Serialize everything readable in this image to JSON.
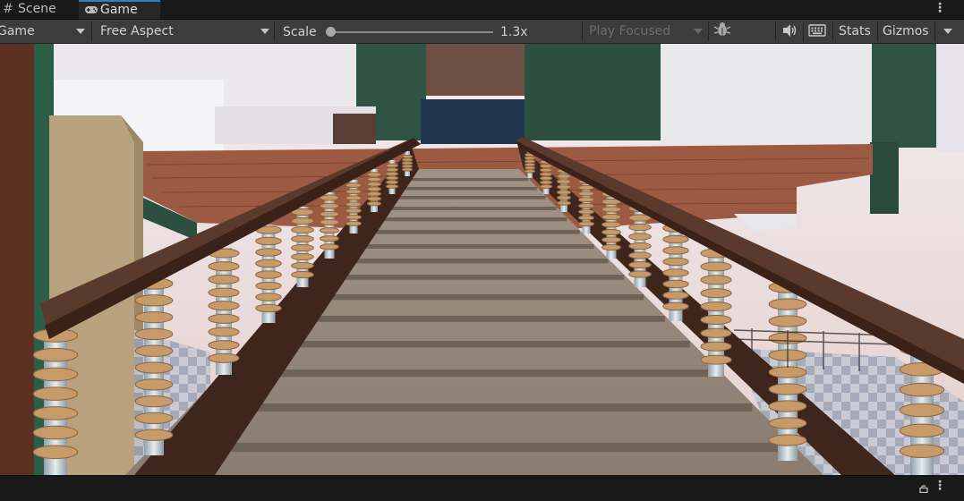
{
  "tabs": {
    "scene": {
      "label": "Scene",
      "icon": "grid-icon"
    },
    "game": {
      "label": "Game",
      "icon": "gamepad-icon"
    },
    "menu_icon": "kebab-menu-icon"
  },
  "toolbar": {
    "display_dropdown": "Game",
    "aspect_dropdown": "Free Aspect",
    "scale_label": "Scale",
    "scale_value": "1.3x",
    "scale_fraction": 0.0,
    "play_mode_dropdown": "Play Focused",
    "bug_icon": "bug-icon",
    "mute_icon": "speaker-icon",
    "keyboard_icon": "keyboard-icon",
    "stats_label": "Stats",
    "gizmos_label": "Gizmos"
  },
  "viewport": {
    "description_icon": "game-viewport"
  },
  "bottom": {
    "lock_icon": "lock-icon",
    "menu_icon": "kebab-menu-icon"
  },
  "colors": {
    "accent": "#3a79bb",
    "panel": "#3c3c3c",
    "background": "#191919"
  }
}
